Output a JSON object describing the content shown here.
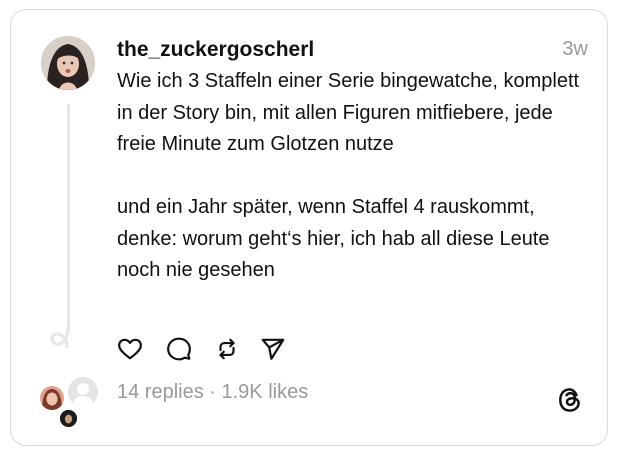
{
  "post": {
    "username": "the_zuckergoscherl",
    "time": "3w",
    "paragraph1": "Wie ich 3 Staffeln einer Serie bingewatche, komplett in der Story bin, mit allen Figuren mitfiebere, jede freie Minute zum Glotzen nutze",
    "paragraph2": "und ein Jahr später, wenn Staffel 4 rauskommt, denke: worum geht‘s hier, ich hab all diese Leute noch nie gesehen",
    "replies": "14 replies",
    "separator": " · ",
    "likes": "1.9K likes"
  },
  "icons": [
    "heart-icon",
    "comment-icon",
    "repost-icon",
    "share-icon",
    "threads-logo-icon"
  ],
  "colors": {
    "text": "#111111",
    "muted": "#999999",
    "border": "#d9d9d9",
    "thread_line": "#e6e6e6"
  }
}
